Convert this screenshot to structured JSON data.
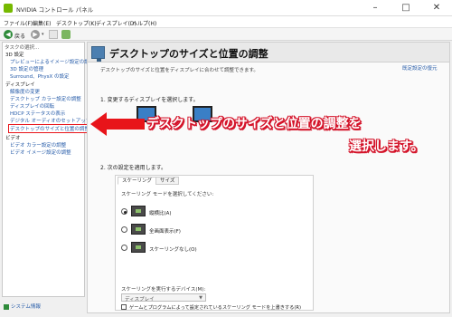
{
  "window": {
    "title": "NVIDIA コントロール パネル",
    "minimize": "–",
    "maximize": "□",
    "close": "✕"
  },
  "menu": [
    "ファイル(F)",
    "編集(E)",
    "デスクトップ(K)",
    "ディスプレイ(D)",
    "ヘルプ(H)"
  ],
  "toolbar": {
    "back_label": "戻る",
    "back_icon": "back-arrow-icon",
    "forward_icon": "forward-arrow-icon",
    "dropdown": "▾",
    "home_icon": "home-icon"
  },
  "sidebar": {
    "header": "タスクの選択...",
    "items": [
      {
        "label": "3D 設定",
        "type": "category"
      },
      {
        "label": "プレビューによるイメージ設定の調整",
        "type": "link"
      },
      {
        "label": "3D 設定の管理",
        "type": "link"
      },
      {
        "label": "Surround、PhysX の設定",
        "type": "link"
      },
      {
        "label": "ディスプレイ",
        "type": "category"
      },
      {
        "label": "解像度の変更",
        "type": "link"
      },
      {
        "label": "デスクトップ カラー設定の調整",
        "type": "link"
      },
      {
        "label": "ディスプレイの回転",
        "type": "link"
      },
      {
        "label": "HDCP ステータスの表示",
        "type": "link"
      },
      {
        "label": "デジタル オーディオのセットアップ",
        "type": "link"
      },
      {
        "label": "デスクトップのサイズと位置の調整",
        "type": "link",
        "selected": true
      },
      {
        "label": "ビデオ",
        "type": "category"
      },
      {
        "label": "ビデオ カラー設定の調整",
        "type": "link"
      },
      {
        "label": "ビデオ イメージ設定の調整",
        "type": "link"
      }
    ],
    "system_info": "システム情報"
  },
  "main": {
    "title": "デスクトップのサイズと位置の調整",
    "restore": "既定設定の復元",
    "description": "デスクトップのサイズと位置をディスプレイに合わせて調整できます。",
    "section1": "1. 変更するディスプレイを選択します。",
    "section2": "2. 次の設定を適用します。",
    "tabs": [
      "スケーリング",
      "サイズ"
    ],
    "mode_label": "スケーリング モードを選択してください:",
    "options": [
      {
        "label": "縦横比(A)",
        "checked": true
      },
      {
        "label": "全画面表示(F)",
        "checked": false
      },
      {
        "label": "スケーリングなし(O)",
        "checked": false
      }
    ],
    "perform_label": "スケーリングを実行するデバイス(M):",
    "perform_value": "ディスプレイ",
    "override_label": "ゲームとプログラムによって設定されているスケーリング モードを上書きする(R)"
  },
  "annotation": {
    "line1": "デスクトップのサイズと位置の調整を",
    "line2": "選択します。",
    "color": "#e8141a"
  }
}
